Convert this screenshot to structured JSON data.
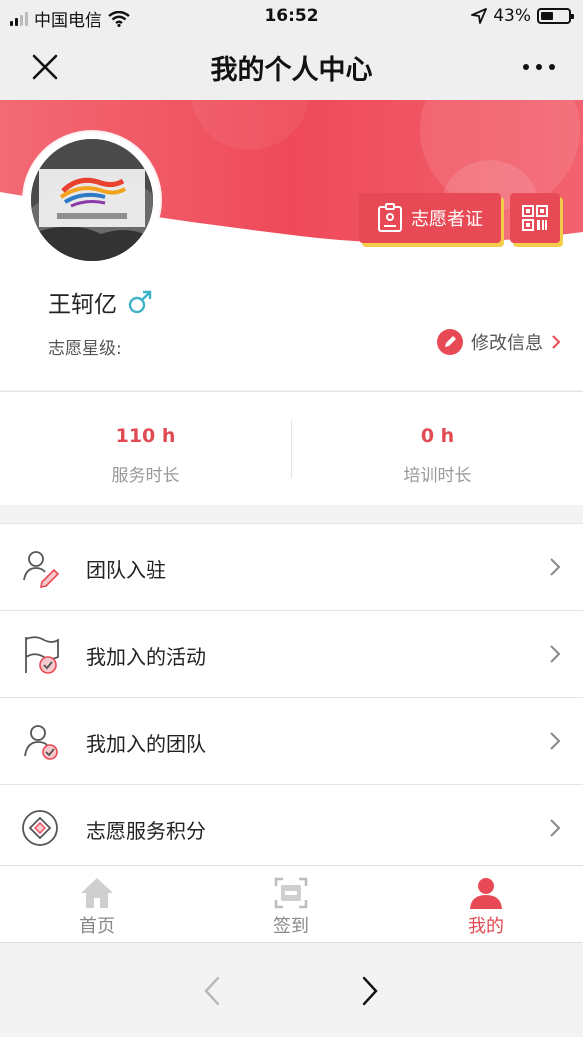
{
  "status_bar": {
    "carrier": "中国电信",
    "time": "16:52",
    "battery": "43%",
    "icons": [
      "signal-icon",
      "wifi-icon",
      "location-arrow-icon",
      "battery-icon"
    ]
  },
  "nav": {
    "title": "我的个人中心",
    "icons": [
      "close-icon",
      "more-icon"
    ]
  },
  "profile": {
    "name": "王轲亿",
    "gender_icon": "male-icon",
    "star_label": "志愿星级:",
    "edit_label": "修改信息",
    "cert_button": "志愿者证",
    "avatar_icon": "volunteer-logo-avatar"
  },
  "stats": [
    {
      "value": "110 h",
      "label": "服务时长"
    },
    {
      "value": "0 h",
      "label": "培训时长"
    }
  ],
  "menu": [
    {
      "label": "团队入驻",
      "icon": "team-join-icon"
    },
    {
      "label": "我加入的活动",
      "icon": "activity-flag-icon"
    },
    {
      "label": "我加入的团队",
      "icon": "joined-team-icon"
    },
    {
      "label": "志愿服务积分",
      "icon": "points-icon"
    }
  ],
  "tabs": [
    {
      "label": "首页",
      "icon": "home-icon",
      "active": false
    },
    {
      "label": "签到",
      "icon": "check-in-icon",
      "active": false
    },
    {
      "label": "我的",
      "icon": "user-icon",
      "active": true
    }
  ],
  "colors": {
    "accent": "#e84a55",
    "accent_text": "#e04a52",
    "highlight": "#f2cc4a",
    "male_icon": "#3cb3c9"
  }
}
